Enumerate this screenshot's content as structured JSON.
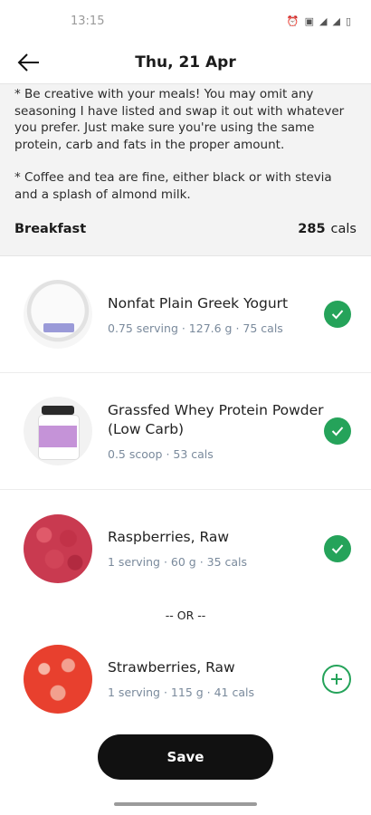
{
  "status": {
    "time": "13:15",
    "icons": [
      "alarm-icon",
      "nfc-icon",
      "signal-icon",
      "signal-icon",
      "battery-icon"
    ]
  },
  "header": {
    "title": "Thu, 21 Apr"
  },
  "notes": [
    "* Be creative with your meals! You may omit any seasoning I have listed and swap it out with whatever you prefer. Just make sure you're using the same protein, carb and fats in the proper amount.",
    "* Coffee and tea are fine, either black or with stevia and a splash of almond milk."
  ],
  "meal": {
    "name": "Breakfast",
    "cals": "285",
    "cals_unit": "cals"
  },
  "items": [
    {
      "name": "Nonfat Plain Greek Yogurt",
      "meta": "0.75 serving · 127.6 g · 75 cals",
      "checked": true,
      "image": "yogurt"
    },
    {
      "name": "Grassfed Whey Protein Powder (Low Carb)",
      "meta": "0.5 scoop · 53 cals",
      "checked": true,
      "image": "protein-jar"
    },
    {
      "name": "Raspberries, Raw",
      "meta": "1 serving · 60 g · 35 cals",
      "checked": true,
      "image": "raspberries"
    },
    {
      "name": "Strawberries, Raw",
      "meta": "1 serving · 115 g · 41 cals",
      "checked": false,
      "image": "strawberries"
    }
  ],
  "or_label": "-- OR --",
  "save_label": "Save",
  "colors": {
    "accent": "#25a35a",
    "section_bg": "#f3f3f3",
    "meta": "#7a8a9c"
  }
}
